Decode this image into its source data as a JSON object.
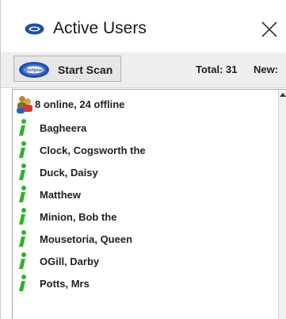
{
  "window": {
    "title": "Active Users",
    "title_icon": "disc-icon",
    "close_glyph": "✕"
  },
  "toolbar": {
    "scan_label": "Start Scan",
    "scan_icon_text": "Bonjour",
    "total_label": "Total: 31",
    "new_label": "New:"
  },
  "list": {
    "summary": "8 online, 24 offline",
    "users": [
      "Bagheera",
      "Clock, Cogsworth the",
      "Duck, Daisy",
      "Matthew",
      "Minion, Bob the",
      "Mousetoria, Queen",
      "OGill, Darby",
      "Potts, Mrs"
    ],
    "status_color": "#2bb52b"
  },
  "colors": {
    "accent": "#1f4fa8",
    "online": "#2bb52b"
  }
}
